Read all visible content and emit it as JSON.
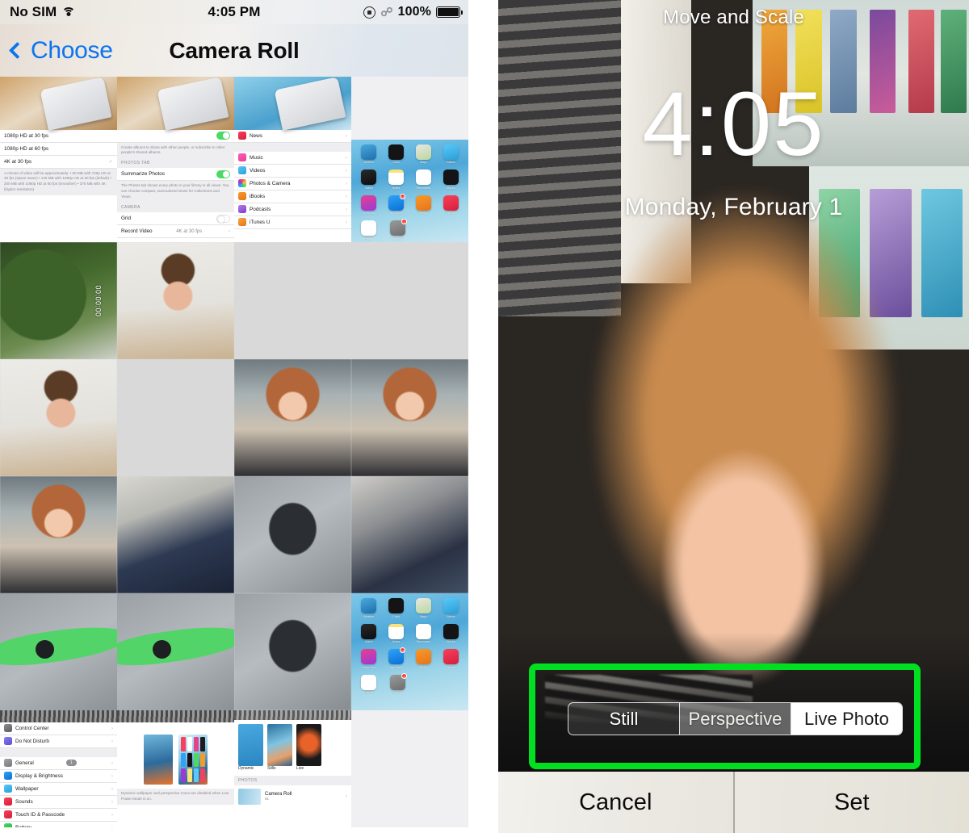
{
  "left": {
    "status_bar": {
      "carrier": "No SIM",
      "wifi_icon": "wifi-icon",
      "time": "4:05 PM",
      "rotation_lock_icon": "rotation-lock-icon",
      "bluetooth_icon": "bluetooth-icon",
      "battery_percent": "100%",
      "battery_icon": "battery-full-icon"
    },
    "nav": {
      "back_icon": "chevron-left-icon",
      "back_label": "Choose",
      "title": "Camera Roll"
    },
    "grid": {
      "rows": [
        [
          {
            "kind": "settings-video",
            "label": "settings-video-quality-screenshot"
          },
          {
            "kind": "settings-photos",
            "label": "settings-photos-screenshot"
          },
          {
            "kind": "settings-apps",
            "label": "settings-app-list-screenshot"
          },
          {
            "kind": "home-screen",
            "label": "ios-home-screen-screenshot"
          }
        ],
        [
          {
            "kind": "video-tree",
            "label": "tree-video",
            "duration": "00:00:00"
          },
          {
            "kind": "face-neutral",
            "label": "man-neutral-photo"
          },
          {
            "kind": "face-smile",
            "label": "man-smiling-photo"
          },
          {
            "kind": "face-smile2",
            "label": "man-smiling-photo-2"
          }
        ],
        [
          {
            "kind": "face-talk",
            "label": "man-talking-photo"
          },
          {
            "kind": "face-wide",
            "label": "man-wide-eyes-photo"
          },
          {
            "kind": "girl-hand",
            "label": "girl-hand-over-mouth-photo"
          },
          {
            "kind": "girl-hand2",
            "label": "girl-hand-over-mouth-photo-2"
          }
        ],
        [
          {
            "kind": "girl-close",
            "label": "girl-close-up-photo"
          },
          {
            "kind": "bike",
            "label": "child-on-bike-photo"
          },
          {
            "kind": "drone",
            "label": "drone-on-ground-photo"
          },
          {
            "kind": "gear",
            "label": "drone-case-photo"
          }
        ],
        [
          {
            "kind": "prop",
            "label": "green-propeller-photo"
          },
          {
            "kind": "prop2",
            "label": "green-propeller-photo-2"
          },
          {
            "kind": "drone-prop",
            "label": "drone-propeller-photo"
          },
          {
            "kind": "home-screen",
            "label": "ios-home-screen-screenshot-2"
          }
        ],
        [
          {
            "kind": "settings-main",
            "label": "settings-main-list-screenshot"
          },
          {
            "kind": "wallpaper-picker",
            "label": "wallpaper-picker-screenshot"
          },
          {
            "kind": "wallpaper-types",
            "label": "wallpaper-types-screenshot"
          },
          {
            "kind": "blank",
            "label": "empty-cell"
          }
        ]
      ]
    },
    "settings_video": {
      "options": [
        "1080p HD at 30 fps",
        "1080p HD at 60 fps",
        "4K at 30 fps"
      ],
      "checked_index": 2,
      "note": "A minute of video will be approximately: • 60 MB with 720p HD at 30 fps (space saver) • 130 MB with 1080p HD at 30 fps (default) • 200 MB with 1080p HD at 60 fps (smoother) • 375 MB with 4K (higher resolution)"
    },
    "settings_photos": {
      "shared_note": "Create albums to share with other people, or subscribe to other people's shared albums.",
      "section_photos_tab": "PHOTOS TAB",
      "summarize_label": "Summarize Photos",
      "summarize_note": "The Photos tab shows every photo in your library in all views. You can choose compact, summarized views for Collections and Years.",
      "section_camera": "CAMERA",
      "grid_label": "Grid",
      "record_video_label": "Record Video",
      "record_video_value": "4K at 30 fps"
    },
    "settings_apps": {
      "items": [
        "News",
        "Music",
        "Videos",
        "Photos & Camera",
        "iBooks",
        "Podcasts",
        "iTunes U"
      ]
    },
    "settings_main": {
      "items": [
        {
          "label": "Control Center",
          "badge": ""
        },
        {
          "label": "Do Not Disturb",
          "badge": ""
        },
        {
          "label": "General",
          "badge": "1"
        },
        {
          "label": "Display & Brightness",
          "badge": ""
        },
        {
          "label": "Wallpaper",
          "badge": ""
        },
        {
          "label": "Sounds",
          "badge": ""
        },
        {
          "label": "Touch ID & Passcode",
          "badge": ""
        },
        {
          "label": "Battery",
          "badge": ""
        }
      ]
    },
    "wallpaper": {
      "types": [
        "Dynamic",
        "Stills",
        "Live"
      ],
      "section_photos": "PHOTOS",
      "album_name": "Camera Roll",
      "album_count": "81",
      "note": "Dynamic wallpaper and perspective zoom are disabled when Low Power Mode is on."
    },
    "home_screen": {
      "apps": [
        [
          {
            "name": "Weather",
            "color1": "#4aa8e0",
            "color2": "#1e6fa8",
            "badge": ""
          },
          {
            "name": "Clock",
            "color1": "#1c1c1e",
            "color2": "#000000",
            "badge": ""
          },
          {
            "name": "Maps",
            "color1": "#e8e6e0",
            "color2": "#b9d8a0",
            "badge": ""
          },
          {
            "name": "Videos",
            "color1": "#5ac8fa",
            "color2": "#2a9fd6",
            "badge": ""
          }
        ],
        [
          {
            "name": "Wallet",
            "color1": "#2a2a2c",
            "color2": "#0d0d0e",
            "badge": ""
          },
          {
            "name": "Notes",
            "color1": "#fbe27a",
            "color2": "#f2cf3c",
            "badge": ""
          },
          {
            "name": "Reminders",
            "color1": "#ffffff",
            "color2": "#efefef",
            "badge": ""
          },
          {
            "name": "Stocks",
            "color1": "#1c1c1e",
            "color2": "#000000",
            "badge": ""
          }
        ],
        [
          {
            "name": "iTunes Store",
            "color1": "#e8408f",
            "color2": "#9b39d6",
            "badge": ""
          },
          {
            "name": "App Store",
            "color1": "#2fa3f7",
            "color2": "#0a6fd6",
            "badge": "10"
          },
          {
            "name": "iBooks",
            "color1": "#f79a2a",
            "color2": "#e8731a",
            "badge": ""
          },
          {
            "name": "News",
            "color1": "#f9405a",
            "color2": "#d41f3c",
            "badge": ""
          }
        ],
        [
          {
            "name": "Health",
            "color1": "#ffffff",
            "color2": "#f2f2f2",
            "badge": ""
          },
          {
            "name": "Settings",
            "color1": "#9b9b9b",
            "color2": "#6e6e6e",
            "badge": "1"
          }
        ]
      ]
    }
  },
  "right": {
    "title": "Move and Scale",
    "lock_time": "4:05",
    "lock_date": "Monday, February 1",
    "segments": [
      {
        "label": "Still",
        "state": "normal"
      },
      {
        "label": "Perspective",
        "state": "dim"
      },
      {
        "label": "Live Photo",
        "state": "active"
      }
    ],
    "highlight_color": "#00e021",
    "cancel_label": "Cancel",
    "set_label": "Set"
  }
}
